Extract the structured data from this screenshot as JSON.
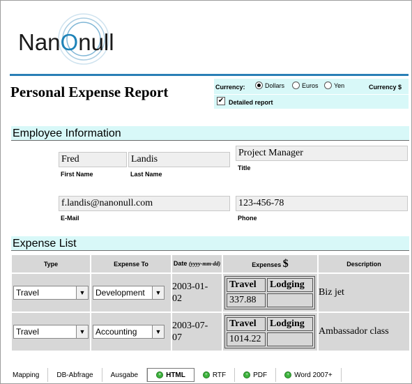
{
  "logo": {
    "text_before": "Nan",
    "text_o": "O",
    "text_after": "null"
  },
  "title": "Personal Expense Report",
  "options": {
    "currency_label": "Currency:",
    "currencies": [
      {
        "label": "Dollars",
        "selected": true
      },
      {
        "label": "Euros",
        "selected": false
      },
      {
        "label": "Yen",
        "selected": false
      }
    ],
    "currency_symbol_label": "Currency $",
    "detailed_label": "Detailed report",
    "detailed_checked": true
  },
  "employee": {
    "section_title": "Employee Information",
    "first_name": "Fred",
    "first_name_label": "First Name",
    "last_name": "Landis",
    "last_name_label": "Last Name",
    "title": "Project Manager",
    "title_label": "Title",
    "email": "f.landis@nanonull.com",
    "email_label": "E-Mail",
    "phone": "123-456-78",
    "phone_label": "Phone"
  },
  "expenses": {
    "section_title": "Expense List",
    "headers": {
      "type": "Type",
      "expense_to": "Expense To",
      "date": "Date",
      "date_format": "(yyyy-mm-dd)",
      "expenses": "Expenses",
      "currency": "$",
      "description": "Description"
    },
    "rows": [
      {
        "type": "Travel",
        "expense_to": "Development",
        "date_line1": "2003-01-",
        "date_line2": "02",
        "col1": "Travel",
        "col2": "Lodging",
        "val1": "337.88",
        "val2": "",
        "description": "Biz jet"
      },
      {
        "type": "Travel",
        "expense_to": "Accounting",
        "date_line1": "2003-07-",
        "date_line2": "07",
        "col1": "Travel",
        "col2": "Lodging",
        "val1": "1014.22",
        "val2": "",
        "description": "Ambassador class"
      }
    ]
  },
  "tabs": [
    {
      "label": "Mapping",
      "icon": false
    },
    {
      "label": "DB-Abfrage",
      "icon": false
    },
    {
      "label": "Ausgabe",
      "icon": false
    },
    {
      "label": "HTML",
      "icon": true,
      "active": true
    },
    {
      "label": "RTF",
      "icon": true
    },
    {
      "label": "PDF",
      "icon": true
    },
    {
      "label": "Word 2007+",
      "icon": true
    }
  ]
}
